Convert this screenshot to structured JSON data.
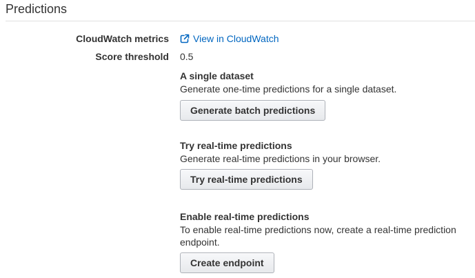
{
  "section": {
    "title": "Predictions"
  },
  "fields": {
    "cloudwatch_label": "CloudWatch metrics",
    "cloudwatch_link": "View in CloudWatch",
    "score_label": "Score threshold",
    "score_value": "0.5"
  },
  "blocks": [
    {
      "title": "A single dataset",
      "description": "Generate one-time predictions for a single dataset.",
      "button": "Generate batch predictions"
    },
    {
      "title": "Try real-time predictions",
      "description": "Generate real-time predictions in your browser.",
      "button": "Try real-time predictions"
    },
    {
      "title": "Enable real-time predictions",
      "description": "To enable real-time predictions now, create a real-time prediction endpoint.",
      "button": "Create endpoint"
    }
  ],
  "icons": {
    "external_link": "external-link-icon"
  },
  "colors": {
    "link": "#0066c0",
    "text": "#333333",
    "divider": "#e0e0e0"
  }
}
